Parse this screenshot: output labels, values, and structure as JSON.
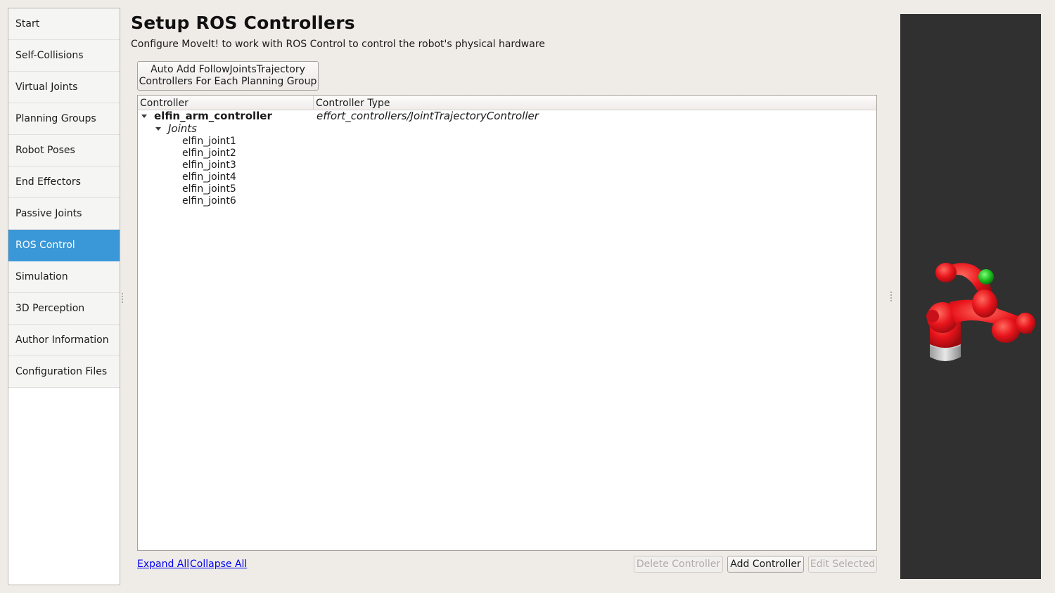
{
  "sidebar": {
    "items": [
      {
        "label": "Start",
        "active": false
      },
      {
        "label": "Self-Collisions",
        "active": false
      },
      {
        "label": "Virtual Joints",
        "active": false
      },
      {
        "label": "Planning Groups",
        "active": false
      },
      {
        "label": "Robot Poses",
        "active": false
      },
      {
        "label": "End Effectors",
        "active": false
      },
      {
        "label": "Passive Joints",
        "active": false
      },
      {
        "label": "ROS Control",
        "active": true
      },
      {
        "label": "Simulation",
        "active": false
      },
      {
        "label": "3D Perception",
        "active": false
      },
      {
        "label": "Author Information",
        "active": false
      },
      {
        "label": "Configuration Files",
        "active": false
      }
    ]
  },
  "header": {
    "title": "Setup ROS Controllers",
    "subtitle": "Configure MoveIt! to work with ROS Control to control the robot's physical hardware"
  },
  "auto_button": {
    "line1": "Auto Add FollowJointsTrajectory",
    "line2": "Controllers For Each Planning Group"
  },
  "tree": {
    "columns": [
      "Controller",
      "Controller Type"
    ],
    "controller": {
      "name": "elfin_arm_controller",
      "type": "effort_controllers/JointTrajectoryController",
      "joints_label": "Joints",
      "joints": [
        "elfin_joint1",
        "elfin_joint2",
        "elfin_joint3",
        "elfin_joint4",
        "elfin_joint5",
        "elfin_joint6"
      ]
    }
  },
  "footer": {
    "expand_all": "Expand All",
    "collapse_all": "Collapse All",
    "delete_controller": "Delete Controller",
    "add_controller": "Add Controller",
    "edit_selected": "Edit Selected"
  },
  "colors": {
    "accent": "#3a97d8",
    "robot": "#e8141b",
    "viewport_bg": "#303030"
  }
}
